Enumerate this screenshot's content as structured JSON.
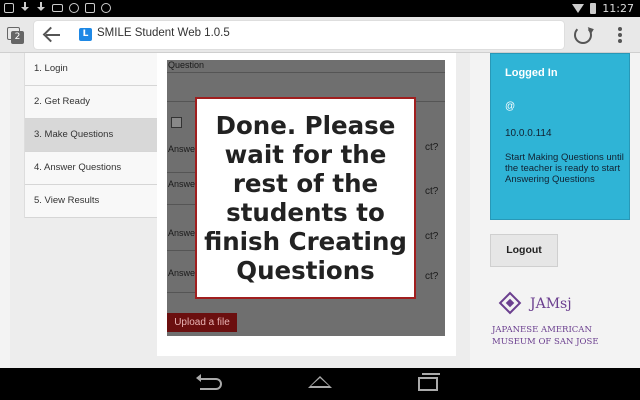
{
  "status_bar": {
    "clock": "11:27",
    "left_icons": [
      "image-icon",
      "download-icon",
      "download-icon",
      "gmail-icon",
      "sync-icon",
      "check-icon",
      "cloud-icon"
    ],
    "right_icons": [
      "wifi-icon",
      "battery-icon"
    ]
  },
  "browser": {
    "tab_count": "2",
    "favicon_letter": "L",
    "url_title": "SMILE Student Web 1.0.5"
  },
  "nav": {
    "items": [
      {
        "label": "1. Login"
      },
      {
        "label": "2. Get Ready"
      },
      {
        "label": "3. Make Questions",
        "active": true
      },
      {
        "label": "4. Answer Questions"
      },
      {
        "label": "5. View Results"
      }
    ]
  },
  "form": {
    "question_label": "Question",
    "answer_label": "Answer",
    "correct_suffix": "ct?",
    "upload_label": "Upload a file"
  },
  "overlay": {
    "message": "Done. Please wait for the rest of the students to finish Creating Questions"
  },
  "status": {
    "title": "Logged In",
    "at": "@",
    "ip": "10.0.0.114",
    "message": "Start Making Questions until the teacher is ready to start Answering Questions"
  },
  "logout_label": "Logout",
  "logo": {
    "mark": "JAMsj",
    "line1": "JAPANESE AMERICAN",
    "line2": "MUSEUM OF SAN JOSE"
  },
  "colors": {
    "status_box": "#2fb4d6",
    "overlay_border": "#a01f1f",
    "upload_button": "#6b0f0f",
    "logo_purple": "#6b3f8f"
  }
}
